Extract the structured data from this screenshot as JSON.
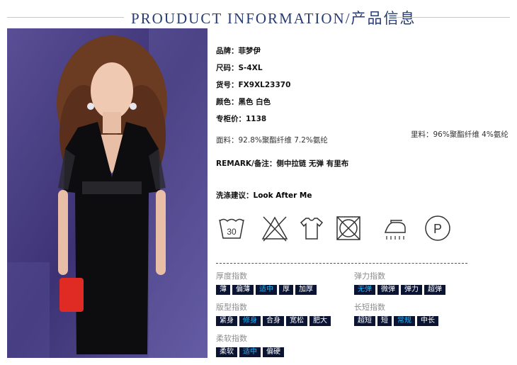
{
  "header": {
    "title": "PROUDUCT INFORMATION/产品信息"
  },
  "product": {
    "brand_label": "品牌：",
    "brand": "菲梦伊",
    "size_label": "尺码：",
    "size": "S-4XL",
    "sku_label": "货号：",
    "sku": "FX9XL23370",
    "color_label": "颜色：",
    "color": "黑色 白色",
    "price_label": "专柜价：",
    "price": "1138",
    "fabric": "面料：92.8%聚酯纤维 7.2%氨纶",
    "lining": "里料：96%聚酯纤维 4%氨纶",
    "remark_label": "REMARK/备注：",
    "remark": "侧中拉链 无弹 有里布",
    "wash_label": "洗涤建议：",
    "wash": "Look After Me"
  },
  "care_icons": [
    {
      "name": "wash-30-icon",
      "label": "30"
    },
    {
      "name": "no-bleach-icon"
    },
    {
      "name": "hang-dry-icon"
    },
    {
      "name": "no-tumble-dry-icon"
    },
    {
      "name": "iron-icon"
    },
    {
      "name": "dry-clean-p-icon",
      "label": "P"
    }
  ],
  "attributes": {
    "thickness": {
      "title": "厚度指数",
      "options": [
        "薄",
        "偏薄",
        "适中",
        "厚",
        "加厚"
      ],
      "selected": 2
    },
    "elasticity": {
      "title": "弹力指数",
      "options": [
        "无弹",
        "微弹",
        "弹力",
        "超弹"
      ],
      "selected": 0
    },
    "fit": {
      "title": "版型指数",
      "options": [
        "紧身",
        "修身",
        "合身",
        "宽松",
        "肥大"
      ],
      "selected": 1
    },
    "length": {
      "title": "长短指数",
      "options": [
        "超短",
        "短",
        "常规",
        "中长"
      ],
      "selected": 2
    },
    "softness": {
      "title": "柔软指数",
      "options": [
        "柔软",
        "适中",
        "偏硬"
      ],
      "selected": 1
    }
  },
  "colors": {
    "title": "#283c74",
    "tag_bg": "#0b1533",
    "tag_active": "#19b6ff"
  }
}
